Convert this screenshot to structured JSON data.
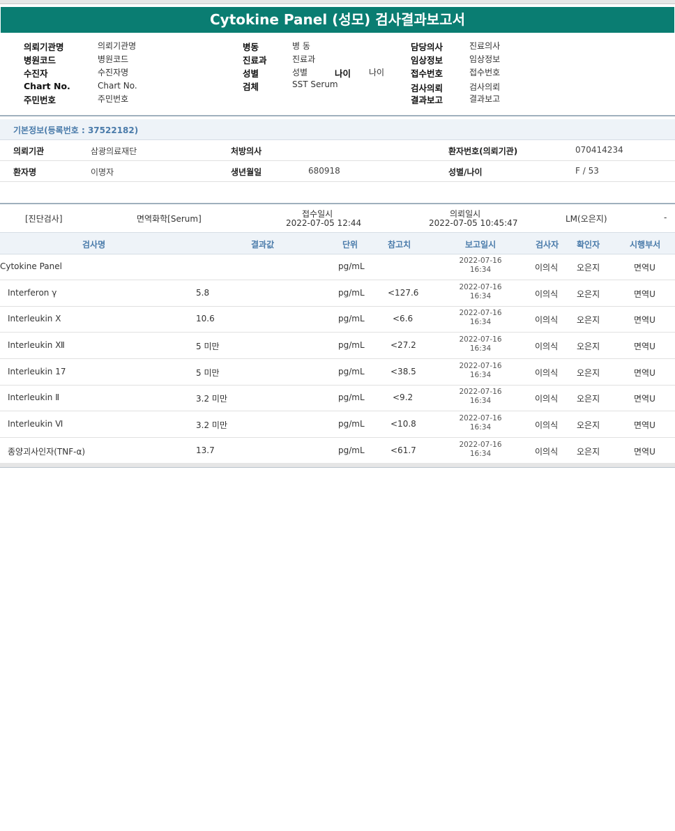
{
  "title": "Cytokine Panel (성모) 검사결과보고서",
  "header": {
    "col1": [
      {
        "label": "의뢰기관명",
        "value": "의뢰기관명"
      },
      {
        "label": "병원코드",
        "value": "병원코드"
      },
      {
        "label": "수진자",
        "value": "수진자명"
      },
      {
        "label": "Chart No.",
        "value": "Chart No."
      },
      {
        "label": "주민번호",
        "value": "주민번호"
      }
    ],
    "col2": [
      {
        "label": "병동",
        "value": "병 동"
      },
      {
        "label": "진료과",
        "value": "진료과"
      },
      {
        "label": "성별",
        "value": "성별",
        "label2": "나이",
        "value2": "나이"
      },
      {
        "label": "검체",
        "value": "SST Serum"
      }
    ],
    "col3": [
      {
        "label": "담당의사",
        "value": "진료의사"
      },
      {
        "label": "임상정보",
        "value": "임상정보"
      },
      {
        "label": "접수번호",
        "value": "접수번호"
      },
      {
        "label": "검사의뢰",
        "value": "검사의뢰"
      },
      {
        "label": "결과보고",
        "value": "결과보고"
      }
    ]
  },
  "basic_info": {
    "title": "기본정보(등록번호 : 37522182)",
    "rows": [
      {
        "l1": "의뢰기관",
        "v1": "삼광의료재단",
        "l2": "처방의사",
        "v2": "",
        "l3": "환자번호(의뢰기관)",
        "v3": "070414234"
      },
      {
        "l1": "환자명",
        "v1": "이명자",
        "l2": "생년월일",
        "v2": "680918",
        "l3": "성별/나이",
        "v3": "F / 53"
      }
    ]
  },
  "order": {
    "category": "[진단검사]",
    "department": "면역화학[Serum]",
    "received_label": "접수일시",
    "received_value": "2022-07-05 12:44",
    "requested_label": "의뢰일시",
    "requested_value": "2022-07-05 10:45:47",
    "lm": "LM(오은지)",
    "dash": "-"
  },
  "table": {
    "headers": [
      "검사명",
      "결과값",
      "단위",
      "참고치",
      "보고일시",
      "검사자",
      "확인자",
      "시행부서"
    ],
    "rows": [
      {
        "name": "Cytokine Panel",
        "result": "",
        "unit": "pg/mL",
        "ref": "",
        "date": "2022-07-16",
        "time": "16:34",
        "tester": "이의식",
        "checker": "오은지",
        "dept": "면역U"
      },
      {
        "name": "Interferon γ",
        "result": "5.8",
        "unit": "pg/mL",
        "ref": "<127.6",
        "date": "2022-07-16",
        "time": "16:34",
        "tester": "이의식",
        "checker": "오은지",
        "dept": "면역U"
      },
      {
        "name": "Interleukin Ⅹ",
        "result": "10.6",
        "unit": "pg/mL",
        "ref": "<6.6",
        "date": "2022-07-16",
        "time": "16:34",
        "tester": "이의식",
        "checker": "오은지",
        "dept": "면역U"
      },
      {
        "name": "Interleukin Ⅻ",
        "result": "5 미만",
        "unit": "pg/mL",
        "ref": "<27.2",
        "date": "2022-07-16",
        "time": "16:34",
        "tester": "이의식",
        "checker": "오은지",
        "dept": "면역U"
      },
      {
        "name": "Interleukin 17",
        "result": "5 미만",
        "unit": "pg/mL",
        "ref": "<38.5",
        "date": "2022-07-16",
        "time": "16:34",
        "tester": "이의식",
        "checker": "오은지",
        "dept": "면역U"
      },
      {
        "name": "Interleukin Ⅱ",
        "result": "3.2 미만",
        "unit": "pg/mL",
        "ref": "<9.2",
        "date": "2022-07-16",
        "time": "16:34",
        "tester": "이의식",
        "checker": "오은지",
        "dept": "면역U"
      },
      {
        "name": "Interleukin Ⅵ",
        "result": "3.2 미만",
        "unit": "pg/mL",
        "ref": "<10.8",
        "date": "2022-07-16",
        "time": "16:34",
        "tester": "이의식",
        "checker": "오은지",
        "dept": "면역U"
      },
      {
        "name": "종양괴사인자(TNF-α)",
        "result": "13.7",
        "unit": "pg/mL",
        "ref": "<61.7",
        "date": "2022-07-16",
        "time": "16:34",
        "tester": "이의식",
        "checker": "오은지",
        "dept": "면역U"
      }
    ]
  }
}
